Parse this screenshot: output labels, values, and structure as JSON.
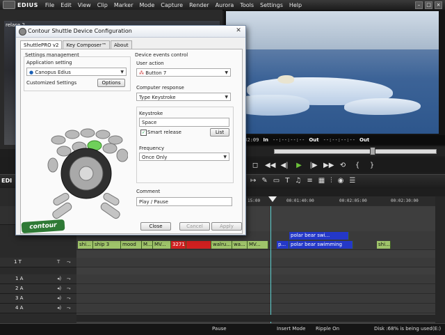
{
  "app": {
    "name": "EDIUS"
  },
  "menu": [
    "File",
    "Edit",
    "View",
    "Clip",
    "Marker",
    "Mode",
    "Capture",
    "Render",
    "Aurora",
    "Tools",
    "Settings",
    "Help"
  ],
  "monitor_left": {
    "label": "relase 2"
  },
  "timecode": {
    "current": "00:01:32:09",
    "in_label": "In",
    "in_value": "--:--:--:--",
    "out_label": "Out",
    "out_value": "--:--:--:--",
    "in2_label": "In",
    "out2_label": "Out",
    "dur_value": "--:--:--:--"
  },
  "timeline": {
    "title": "EDI",
    "ruler": [
      "15:00",
      "00:01:40:00",
      "00:02:05:00",
      "00:02:30:00"
    ],
    "tracks": [
      {
        "name": "1 T"
      },
      {
        "name": "1 A"
      },
      {
        "name": "2 A"
      },
      {
        "name": "3 A"
      },
      {
        "name": "4 A"
      }
    ],
    "vclips_upper": [
      "polar bear swi...",
      "polar bear swimming"
    ],
    "vclips": [
      "shi...",
      "ship 3",
      "mood",
      "M...",
      "MV...",
      "3271",
      "",
      "walru...",
      "wa...",
      "MV...",
      "p...",
      "polar bear swimming",
      "shi..."
    ]
  },
  "status": {
    "mode": "Pause",
    "insert": "Insert Mode",
    "ripple": "Ripple On",
    "disk": "Disk :68% is being used(E:)"
  },
  "dialog": {
    "title": "Contour Shuttle Device Configuration",
    "tabs": [
      "ShuttlePRO v2",
      "Key Composer™",
      "About"
    ],
    "settings_mgmt": "Settings management",
    "app_setting_label": "Application setting",
    "app_setting_value": "Canopus Edius",
    "customized": "Customized Settings",
    "options_btn": "Options",
    "device_events": "Device events control",
    "user_action_label": "User action",
    "user_action_value": "Button 7",
    "computer_response_label": "Computer response",
    "computer_response_value": "Type Keystroke",
    "keystroke_label": "Keystroke",
    "keystroke_value": "Space",
    "smart_release": "Smart release",
    "list_btn": "List",
    "frequency_label": "Frequency",
    "frequency_value": "Once Only",
    "comment_label": "Comment",
    "comment_value": "Play / Pause",
    "close_btn": "Close",
    "cancel_btn": "Cancel",
    "apply_btn": "Apply",
    "logo_text": "contour"
  }
}
